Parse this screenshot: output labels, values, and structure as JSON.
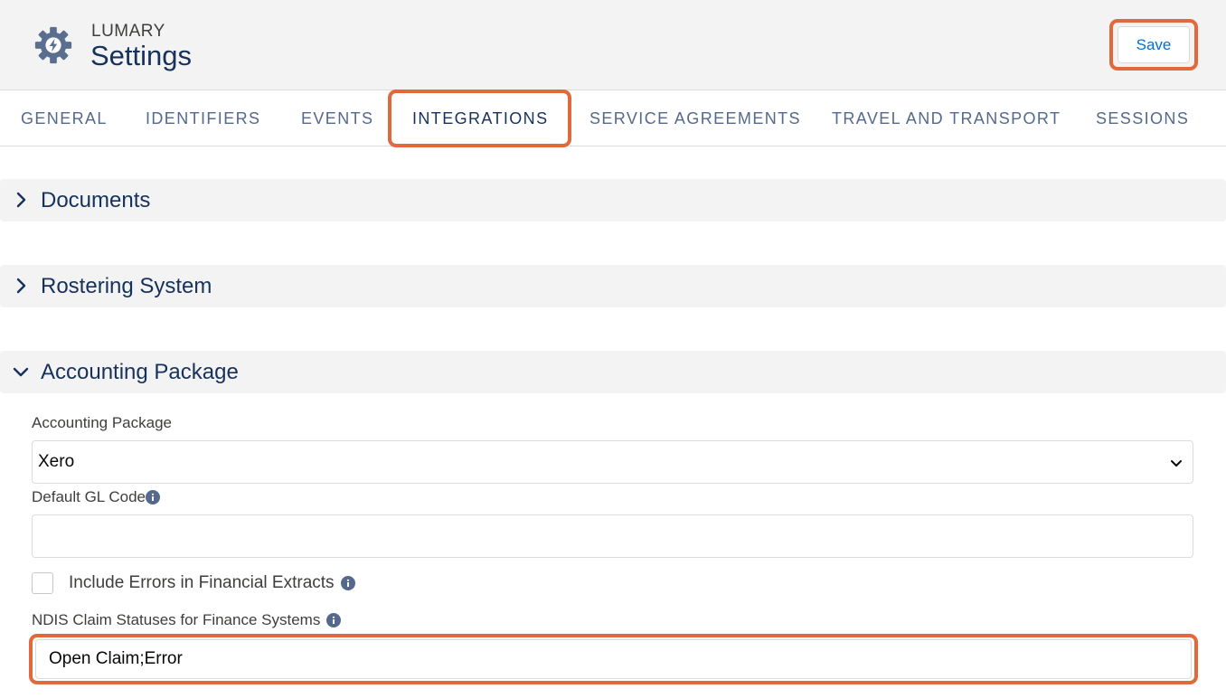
{
  "header": {
    "eyebrow": "LUMARY",
    "title": "Settings",
    "app_icon": "gear-bolt-icon",
    "save_label": "Save"
  },
  "tabs": [
    {
      "label": "GENERAL",
      "active": false
    },
    {
      "label": "IDENTIFIERS",
      "active": false
    },
    {
      "label": "EVENTS",
      "active": false
    },
    {
      "label": "INTEGRATIONS",
      "active": true
    },
    {
      "label": "SERVICE AGREEMENTS",
      "active": false
    },
    {
      "label": "TRAVEL AND TRANSPORT",
      "active": false
    },
    {
      "label": "SESSIONS",
      "active": false
    }
  ],
  "sections": [
    {
      "title": "Documents",
      "expanded": false
    },
    {
      "title": "Rostering System",
      "expanded": false
    },
    {
      "title": "Accounting Package",
      "expanded": true
    }
  ],
  "accounting": {
    "package_label": "Accounting Package",
    "package_value": "Xero",
    "gl_code_label": "Default GL Code",
    "gl_code_value": "",
    "include_errors_label": "Include Errors in Financial Extracts",
    "include_errors_checked": false,
    "ndis_label": "NDIS Claim Statuses for Finance Systems",
    "ndis_value": "Open Claim;Error"
  },
  "colors": {
    "highlight": "#e06a3c",
    "brand_text": "#16325c",
    "link": "#0070d2"
  }
}
